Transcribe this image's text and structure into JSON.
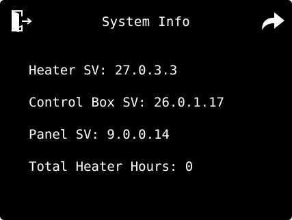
{
  "header": {
    "title": "System Info",
    "exit_icon": "exit-door-icon",
    "next_icon": "forward-arrow-icon"
  },
  "info": [
    {
      "label": "Heater SV:",
      "value": "27.0.3.3"
    },
    {
      "label": "Control Box SV:",
      "value": "26.0.1.17"
    },
    {
      "label": "Panel SV:",
      "value": "9.0.0.14"
    },
    {
      "label": "Total Heater Hours:",
      "value": "0"
    }
  ],
  "colors": {
    "background": "#000000",
    "text": "#ffffff"
  }
}
